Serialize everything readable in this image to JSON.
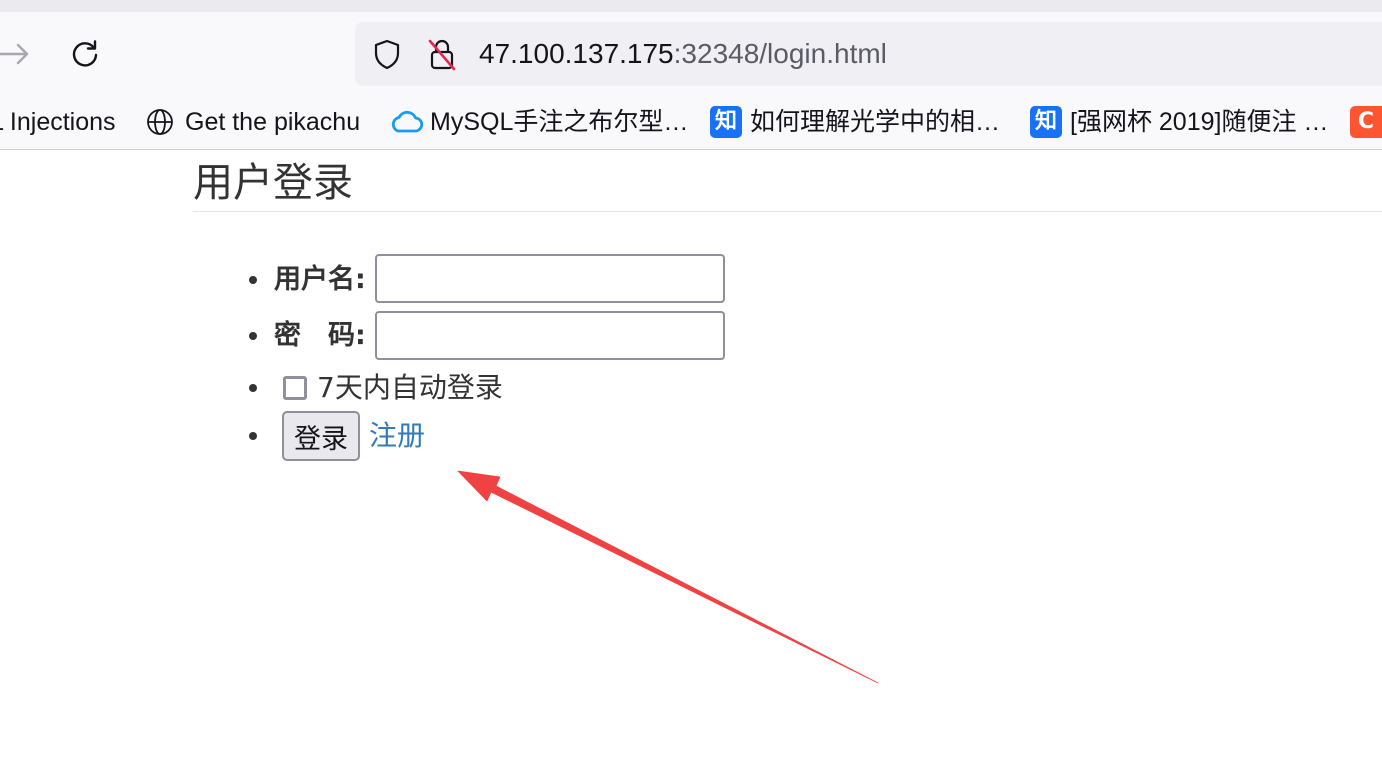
{
  "browser": {
    "nav": {
      "forward_icon": "arrow-right-icon",
      "reload_icon": "reload-icon"
    },
    "urlbar": {
      "shield_icon": "shield-icon",
      "insecure_icon": "insecure-lock-icon",
      "host": "47.100.137.175",
      "path": ":32348/login.html"
    },
    "bookmarks": [
      {
        "label": "L Injections"
      },
      {
        "icon": "globe-icon",
        "label": "Get the pikachu"
      },
      {
        "icon": "cloud-icon",
        "label": "MySQL手注之布尔型…"
      },
      {
        "icon": "zhihu-icon",
        "icon_text": "知",
        "label": "如何理解光学中的相…"
      },
      {
        "icon": "zhihu-icon",
        "icon_text": "知",
        "label": "[强网杯 2019]随便注 …"
      },
      {
        "icon": "csdn-icon",
        "icon_text": "C"
      }
    ]
  },
  "login": {
    "title": "用户登录",
    "username_label": "用户名:",
    "username_value": "",
    "password_label": "密　码:",
    "password_value": "",
    "remember_label": "7天内自动登录",
    "remember_checked": false,
    "submit_label": "登录",
    "register_label": "注册"
  },
  "annotation": {
    "icon": "red-arrow-icon"
  },
  "colors": {
    "link": "#337ab7",
    "annotation": "#f04242",
    "zhihu": "#1772f6",
    "csdn": "#fc5531",
    "cloud": "#1a9bf0",
    "insecure": "#e22850",
    "text": "#333333"
  }
}
